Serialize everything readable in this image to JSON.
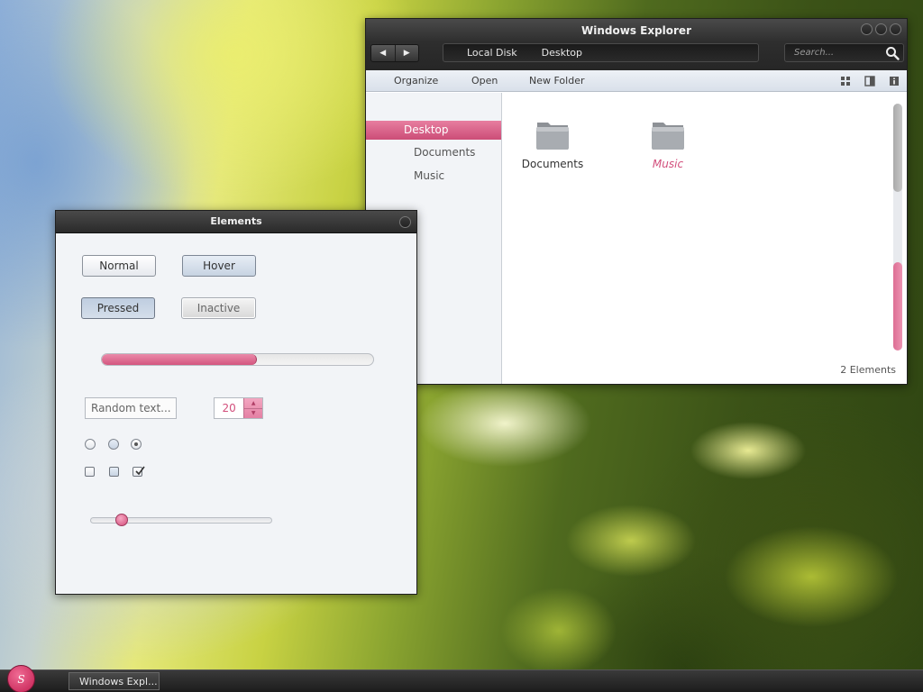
{
  "explorer": {
    "title": "Windows Explorer",
    "address": [
      "Local Disk",
      "Desktop"
    ],
    "search_placeholder": "Search...",
    "toolbar": {
      "organize": "Organize",
      "open": "Open",
      "new_folder": "New Folder"
    },
    "sidebar": [
      "Desktop",
      "Documents",
      "Music"
    ],
    "files": [
      "Documents",
      "Music"
    ],
    "status": "2 Elements"
  },
  "elements": {
    "title": "Elements",
    "buttons": {
      "normal": "Normal",
      "hover": "Hover",
      "pressed": "Pressed",
      "inactive": "Inactive"
    },
    "progress": 0.57,
    "text_field_value": "Random text...",
    "spinner_value": "20",
    "slider_value": 0.17
  },
  "taskbar": {
    "start_label": "S",
    "window_item": "Windows Expl..."
  },
  "colors": {
    "accent": "#d8567f",
    "titlebar": "#2e2e2e"
  }
}
